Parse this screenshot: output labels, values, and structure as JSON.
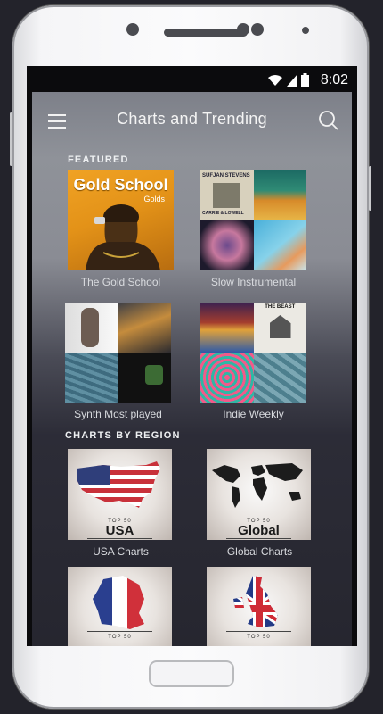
{
  "status": {
    "time": "8:02"
  },
  "appbar": {
    "title": "Charts and Trending"
  },
  "featured": {
    "label": "FEATURED",
    "items": [
      {
        "caption": "The Gold School",
        "art_title": "Gold School",
        "art_subtitle": "Golds"
      },
      {
        "caption": "Slow Instrumental",
        "art_text_1": "SUFJAN STEVENS",
        "art_text_2": "CARRIE & LOWELL"
      },
      {
        "caption": "Synth Most played"
      },
      {
        "caption": "Indie Weekly",
        "art_text_1": "THE BEAST"
      }
    ]
  },
  "regions": {
    "label": "CHARTS BY REGION",
    "top_text": "TOP 50",
    "items": [
      {
        "caption": "USA Charts",
        "art_name": "USA"
      },
      {
        "caption": "Global Charts",
        "art_name": "Global"
      },
      {
        "caption": ""
      },
      {
        "caption": ""
      }
    ]
  },
  "colors": {
    "accent": "#f0a224",
    "text": "#d8dade"
  }
}
